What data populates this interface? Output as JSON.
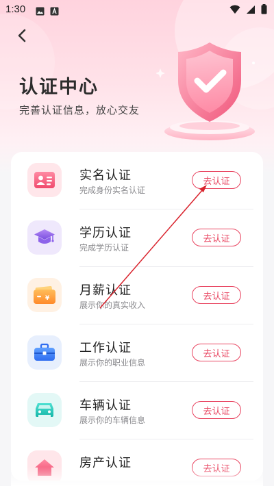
{
  "status_bar": {
    "time": "1:30",
    "left_icons": [
      "image-icon",
      "keyboard-a-icon"
    ],
    "right_icons": [
      "wifi-icon",
      "signal-icon",
      "battery-icon"
    ]
  },
  "header": {
    "title": "认证中心",
    "subtitle": "完善认证信息，放心交友",
    "back_icon": "chevron-left-icon",
    "illustration": "shield-check-icon"
  },
  "colors": {
    "accent": "#e8435f",
    "hero_top": "#ffd3de",
    "page_bg": "#f6f6f8"
  },
  "items": [
    {
      "title": "实名认证",
      "desc": "完成身份实名认证",
      "button": "去认证",
      "icon": "id-card-icon",
      "icon_bg": "#ffe6ea"
    },
    {
      "title": "学历认证",
      "desc": "完成学历认证",
      "button": "去认证",
      "icon": "graduation-cap-icon",
      "icon_bg": "#efe8fc"
    },
    {
      "title": "月薪认证",
      "desc": "展示你的真实收入",
      "button": "去认证",
      "icon": "wallet-icon",
      "icon_bg": "#fff1e3"
    },
    {
      "title": "工作认证",
      "desc": "展示你的职业信息",
      "button": "去认证",
      "icon": "briefcase-icon",
      "icon_bg": "#e7effd"
    },
    {
      "title": "车辆认证",
      "desc": "展示你的车辆信息",
      "button": "去认证",
      "icon": "car-icon",
      "icon_bg": "#e3f8f6"
    },
    {
      "title": "房产认证",
      "desc": "",
      "button": "去认证",
      "icon": "house-icon",
      "icon_bg": "#ffe6ea"
    }
  ]
}
